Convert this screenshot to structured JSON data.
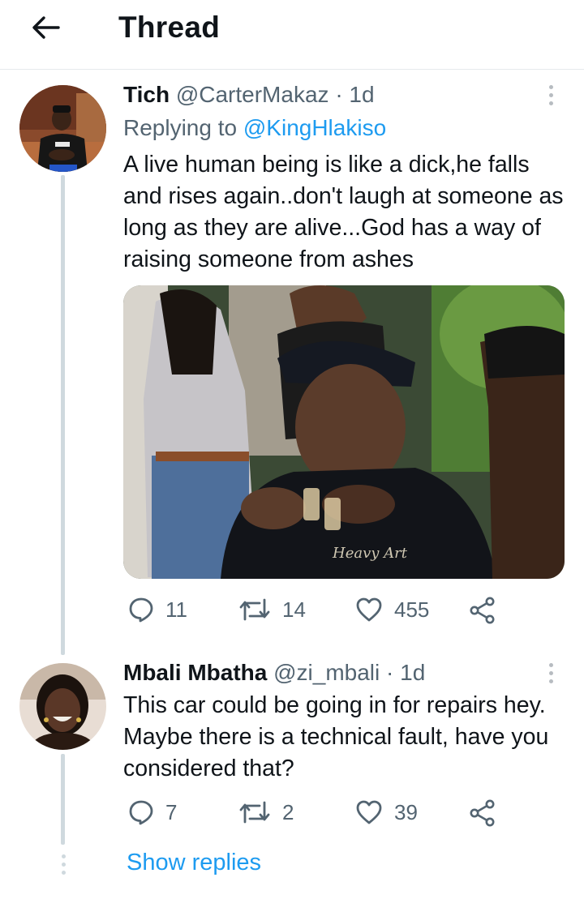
{
  "header": {
    "title": "Thread"
  },
  "tweets": [
    {
      "name": "Tich",
      "handle": "@CarterMakaz",
      "separator": "·",
      "time": "1d",
      "replying_prefix": "Replying to ",
      "replying_to": "@KingHlakiso",
      "text": "A live human being is like a dick,he falls and rises again..don't laugh at someone as long as they are alive...God has a way of raising someone from ashes",
      "replies": "11",
      "retweets": "14",
      "likes": "455",
      "media": {
        "watermark": "Heavy Art"
      }
    },
    {
      "name": "Mbali Mbatha",
      "handle": "@zi_mbali",
      "separator": "·",
      "time": "1d",
      "text": "This car could be going in for repairs hey. Maybe there is a technical fault, have you considered that?",
      "replies": "7",
      "retweets": "2",
      "likes": "39"
    }
  ],
  "show_replies": "Show replies",
  "icons": {
    "back": "arrow-left-icon",
    "more": "more-vertical-icon",
    "reply": "reply-bubble-icon",
    "retweet": "retweet-icon",
    "like": "heart-icon",
    "share": "share-icon"
  },
  "colors": {
    "link": "#1d9bf0",
    "secondary_text": "#536471",
    "thread_line": "#cfd9de"
  }
}
